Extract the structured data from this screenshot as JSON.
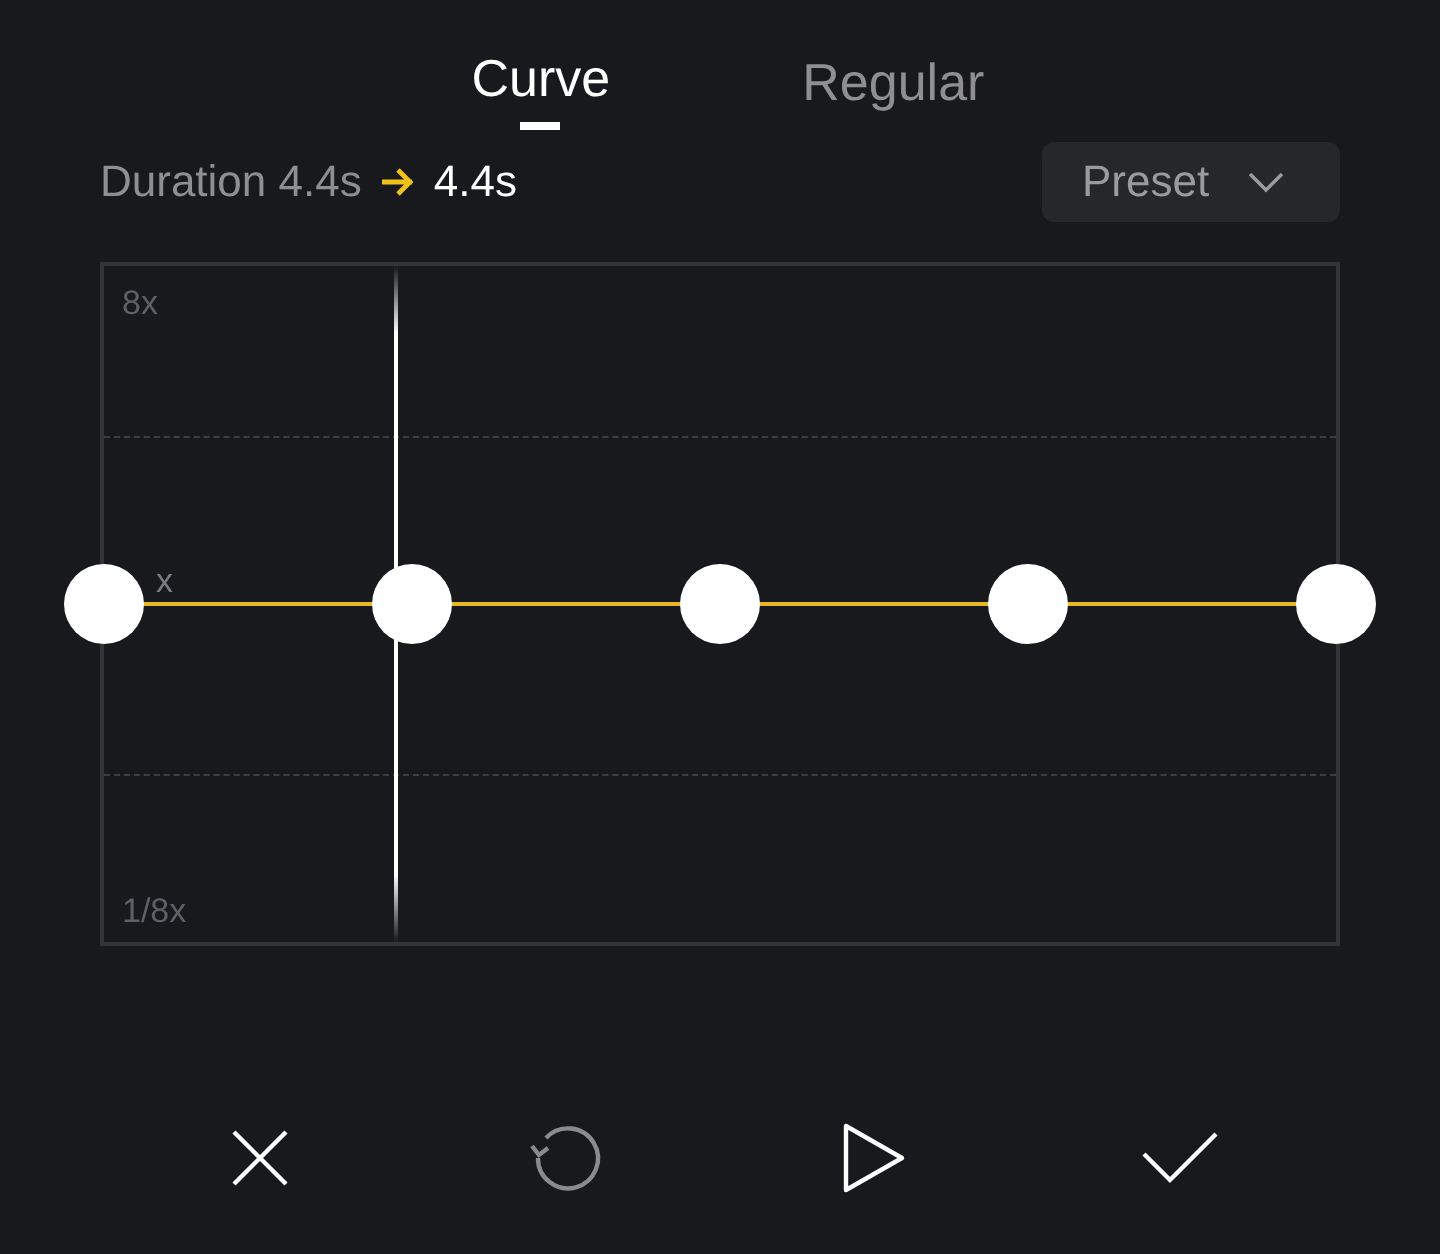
{
  "tabs": [
    {
      "label": "Curve",
      "selected": true
    },
    {
      "label": "Regular",
      "selected": false
    }
  ],
  "duration": {
    "label": "Duration 4.4s",
    "value": "4.4s"
  },
  "preset": {
    "label": "Preset"
  },
  "curve": {
    "labels": [
      "8x",
      "x",
      "1/8x"
    ],
    "playhead": {
      "level": 0.237
    }
  },
  "actions": [
    {
      "kind": "cancel",
      "disabled": false
    },
    {
      "kind": "reset",
      "disabled": true
    },
    {
      "kind": "play",
      "disabled": false
    },
    {
      "kind": "confirm",
      "disabled": false
    }
  ]
}
